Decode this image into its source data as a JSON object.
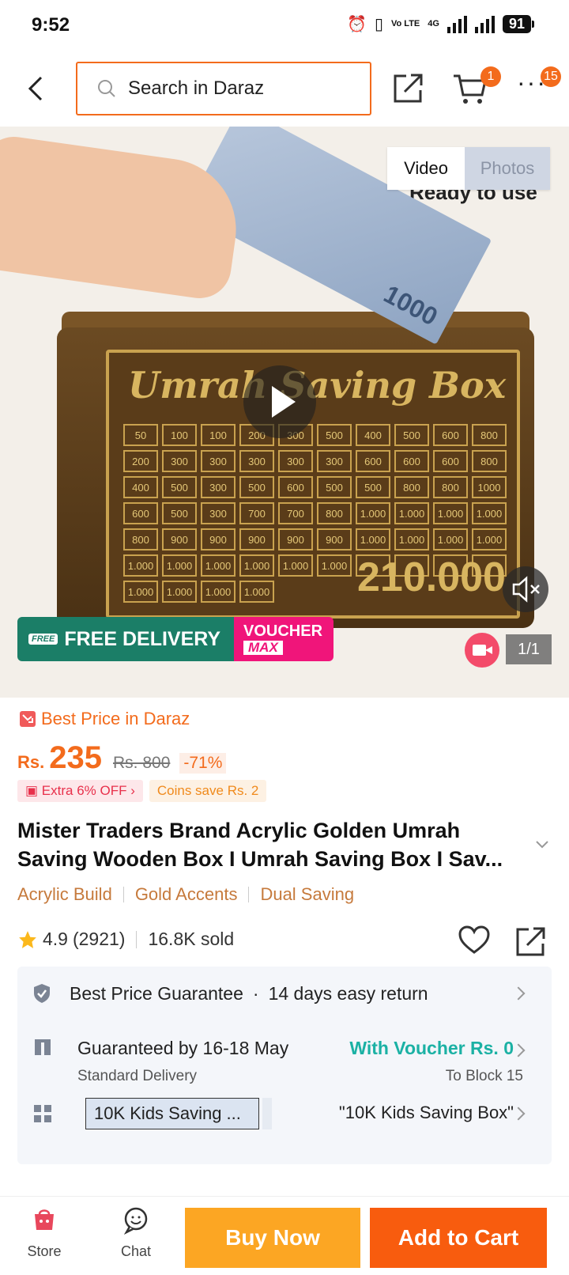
{
  "status": {
    "time": "9:52",
    "network": "Vo LTE",
    "network2": "4G",
    "battery": "91"
  },
  "topbar": {
    "search_placeholder": "Search in Daraz",
    "cart_count": "1",
    "more_count": "15"
  },
  "gallery": {
    "tab_video": "Video",
    "tab_photos": "Photos",
    "image_caption": "Ready to use",
    "box_title": "Umrah Saving Box",
    "box_amount": "210.000",
    "bill_value": "1000",
    "grid": [
      "50",
      "100",
      "100",
      "200",
      "300",
      "500",
      "400",
      "500",
      "600",
      "800",
      "200",
      "300",
      "300",
      "300",
      "300",
      "300",
      "600",
      "600",
      "600",
      "800",
      "400",
      "500",
      "300",
      "500",
      "600",
      "500",
      "500",
      "800",
      "800",
      "1000",
      "600",
      "500",
      "300",
      "700",
      "700",
      "800",
      "1.000",
      "1.000",
      "1.000",
      "1.000",
      "800",
      "900",
      "900",
      "900",
      "900",
      "900",
      "1.000",
      "1.000",
      "1.000",
      "1.000",
      "1.000",
      "1.000",
      "1.000",
      "1.000",
      "1.000",
      "1.000",
      "",
      "",
      "",
      "",
      "1.000",
      "1.000",
      "1.000",
      "1.000",
      "",
      "",
      "",
      "",
      "",
      ""
    ],
    "free_tag": "FREE",
    "free_delivery": "FREE DELIVERY",
    "voucher": "VOUCHER",
    "voucher_max": "MAX",
    "counter": "1/1"
  },
  "price": {
    "best_label": "Best Price in Daraz",
    "currency": "Rs.",
    "current": "235",
    "original": "Rs. 800",
    "discount": "-71%",
    "extra_off": "Extra 6% OFF",
    "coins": "Coins save Rs. 2"
  },
  "product": {
    "title": "Mister Traders Brand Acrylic Golden Umrah Saving Wooden Box I Umrah Saving Box I Sav...",
    "features": [
      "Acrylic Build",
      "Gold Accents",
      "Dual Saving"
    ],
    "rating": "4.9",
    "reviews": "(2921)",
    "sold": "16.8K sold"
  },
  "info": {
    "guarantee": "Best Price Guarantee",
    "return": "14 days easy return",
    "delivery": "Guaranteed by 16-18 May",
    "delivery_type": "Standard Delivery",
    "voucher": "With Voucher Rs. 0",
    "location": "To Block 15",
    "variant_selected": "10K Kids Saving ...",
    "variant_full": "\"10K Kids Saving Box\""
  },
  "bottom": {
    "store": "Store",
    "chat": "Chat",
    "buy_now": "Buy Now",
    "add_to_cart": "Add to Cart"
  },
  "colors": {
    "accent": "#f36b1c",
    "buy_now": "#fca623",
    "add_to_cart": "#f85c0e",
    "teal": "#1bb1a4"
  }
}
